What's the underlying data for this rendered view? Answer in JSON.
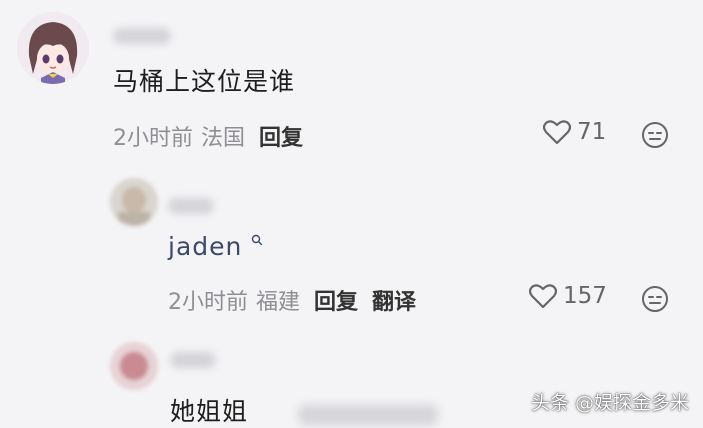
{
  "comments": [
    {
      "text": "马桶上这位是谁",
      "time": "2小时前",
      "location": "法国",
      "reply_label": "回复",
      "likes": "71"
    },
    {
      "text": "jaden",
      "time": "2小时前",
      "location": "福建",
      "reply_label": "回复",
      "translate_label": "翻译",
      "likes": "157"
    },
    {
      "text": "她姐姐"
    }
  ],
  "watermark": "头条 @娱探金多米",
  "colors": {
    "background": "#f4f4f6",
    "meta_text": "#8e8e93",
    "link_text": "#3b4a6b"
  },
  "icons": [
    "heart-icon",
    "emoji-icon",
    "search-icon"
  ]
}
